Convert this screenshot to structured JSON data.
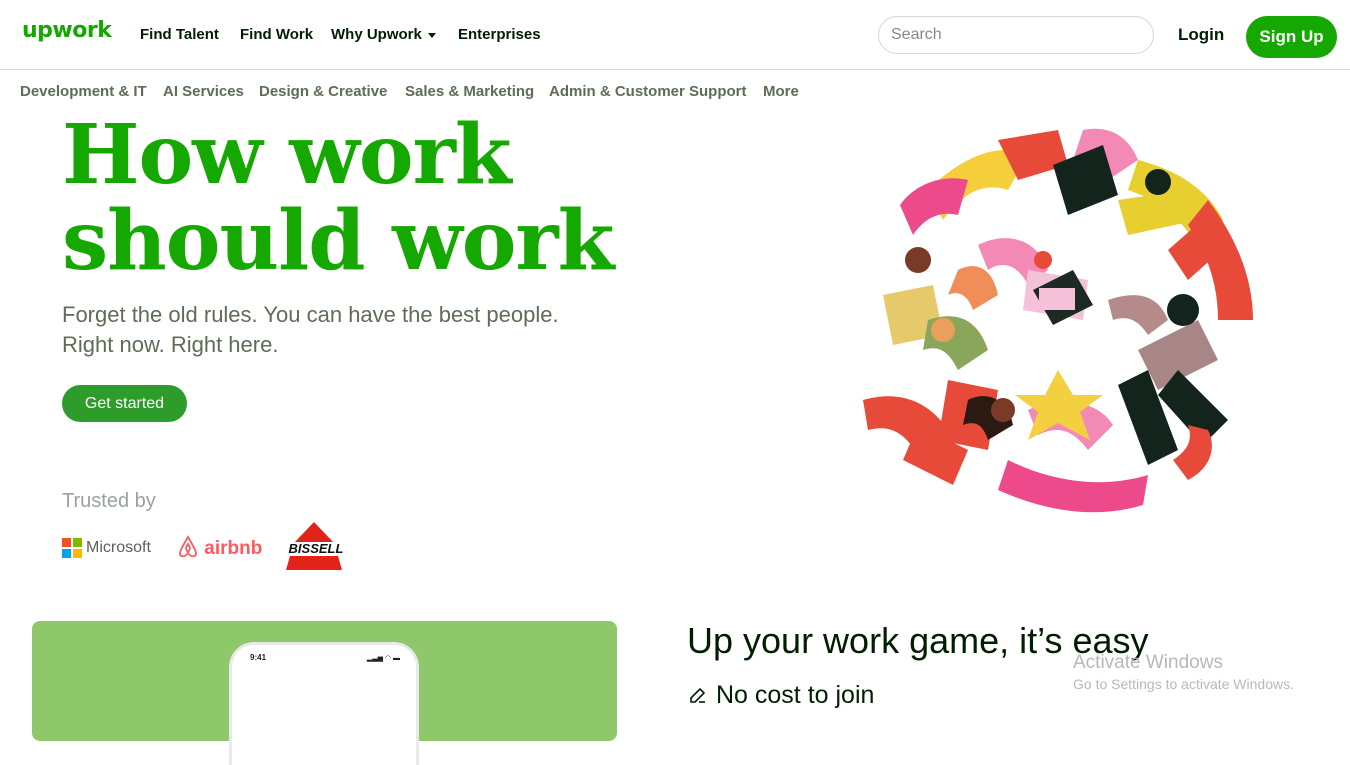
{
  "header": {
    "logo": "upwork",
    "nav": [
      "Find Talent",
      "Find Work",
      "Why Upwork",
      "Enterprises"
    ],
    "search_placeholder": "Search",
    "login": "Login",
    "signup": "Sign Up"
  },
  "categories": [
    "Development & IT",
    "AI Services",
    "Design & Creative",
    "Sales & Marketing",
    "Admin & Customer Support",
    "More"
  ],
  "hero": {
    "title_line1": "How work",
    "title_line2": "should work",
    "subtitle_line1": "Forget the old rules. You can have the best people.",
    "subtitle_line2": "Right now. Right here.",
    "cta": "Get started"
  },
  "trusted": {
    "label": "Trusted by",
    "brands": [
      "Microsoft",
      "airbnb",
      "BISSELL"
    ]
  },
  "section": {
    "heading": "Up your work game, it’s easy",
    "feature1": "No cost to join",
    "phone_time": "9:41"
  },
  "watermark": {
    "line1": "Activate Windows",
    "line2": "Go to Settings to activate Windows."
  },
  "colors": {
    "brand_green": "#14a800",
    "cta_green": "#2d9c2a",
    "card_green": "#8ec86a"
  }
}
